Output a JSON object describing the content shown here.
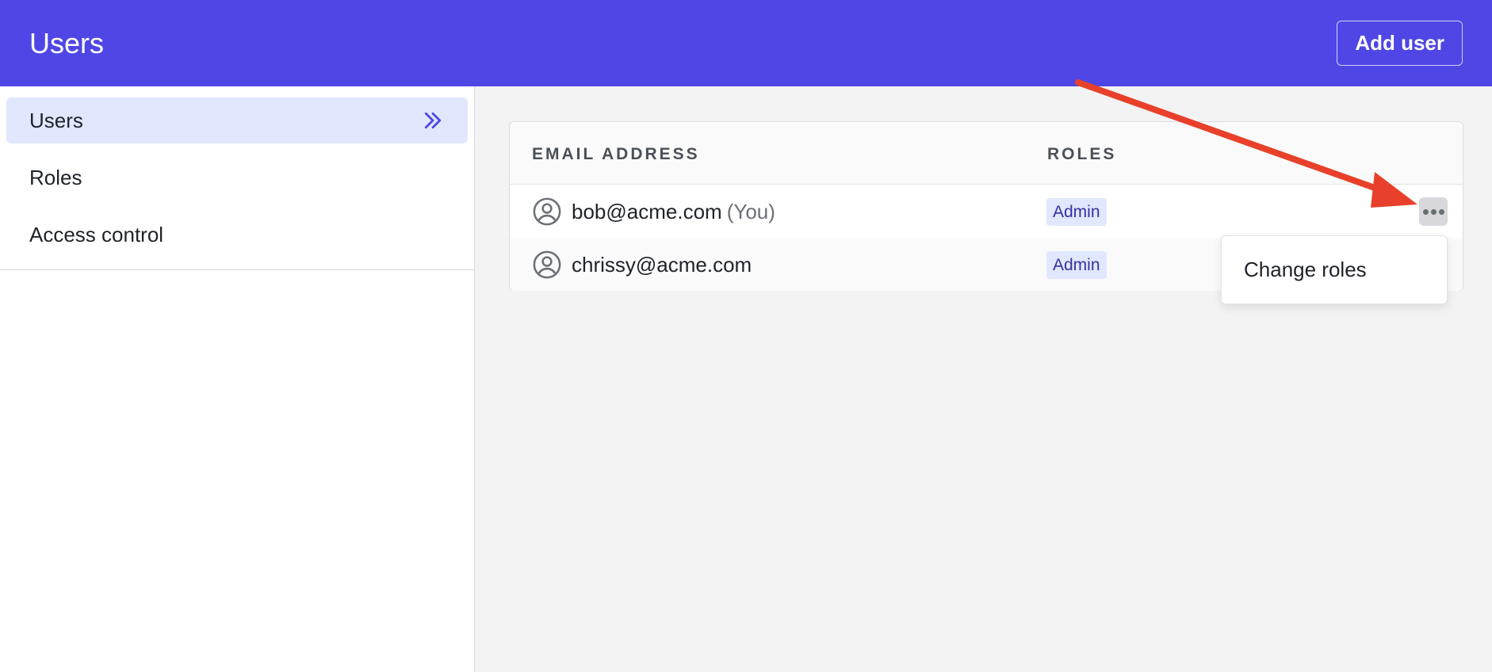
{
  "header": {
    "title": "Users",
    "add_user_label": "Add user"
  },
  "sidebar": {
    "items": [
      {
        "label": "Users",
        "active": true,
        "icon": "chevrons-right-icon"
      },
      {
        "label": "Roles",
        "active": false
      },
      {
        "label": "Access control",
        "active": false
      }
    ]
  },
  "table": {
    "columns": [
      "EMAIL ADDRESS",
      "ROLES"
    ],
    "rows": [
      {
        "email": "bob@acme.com",
        "you_label": "(You)",
        "role": "Admin"
      },
      {
        "email": "chrissy@acme.com",
        "you_label": "",
        "role": "Admin"
      }
    ]
  },
  "menu": {
    "items": [
      "Change roles"
    ]
  },
  "colors": {
    "header": "#4f46e5",
    "badge_bg": "#e0e7ff",
    "badge_text": "#3730a3",
    "arrow": "#e8402a"
  }
}
